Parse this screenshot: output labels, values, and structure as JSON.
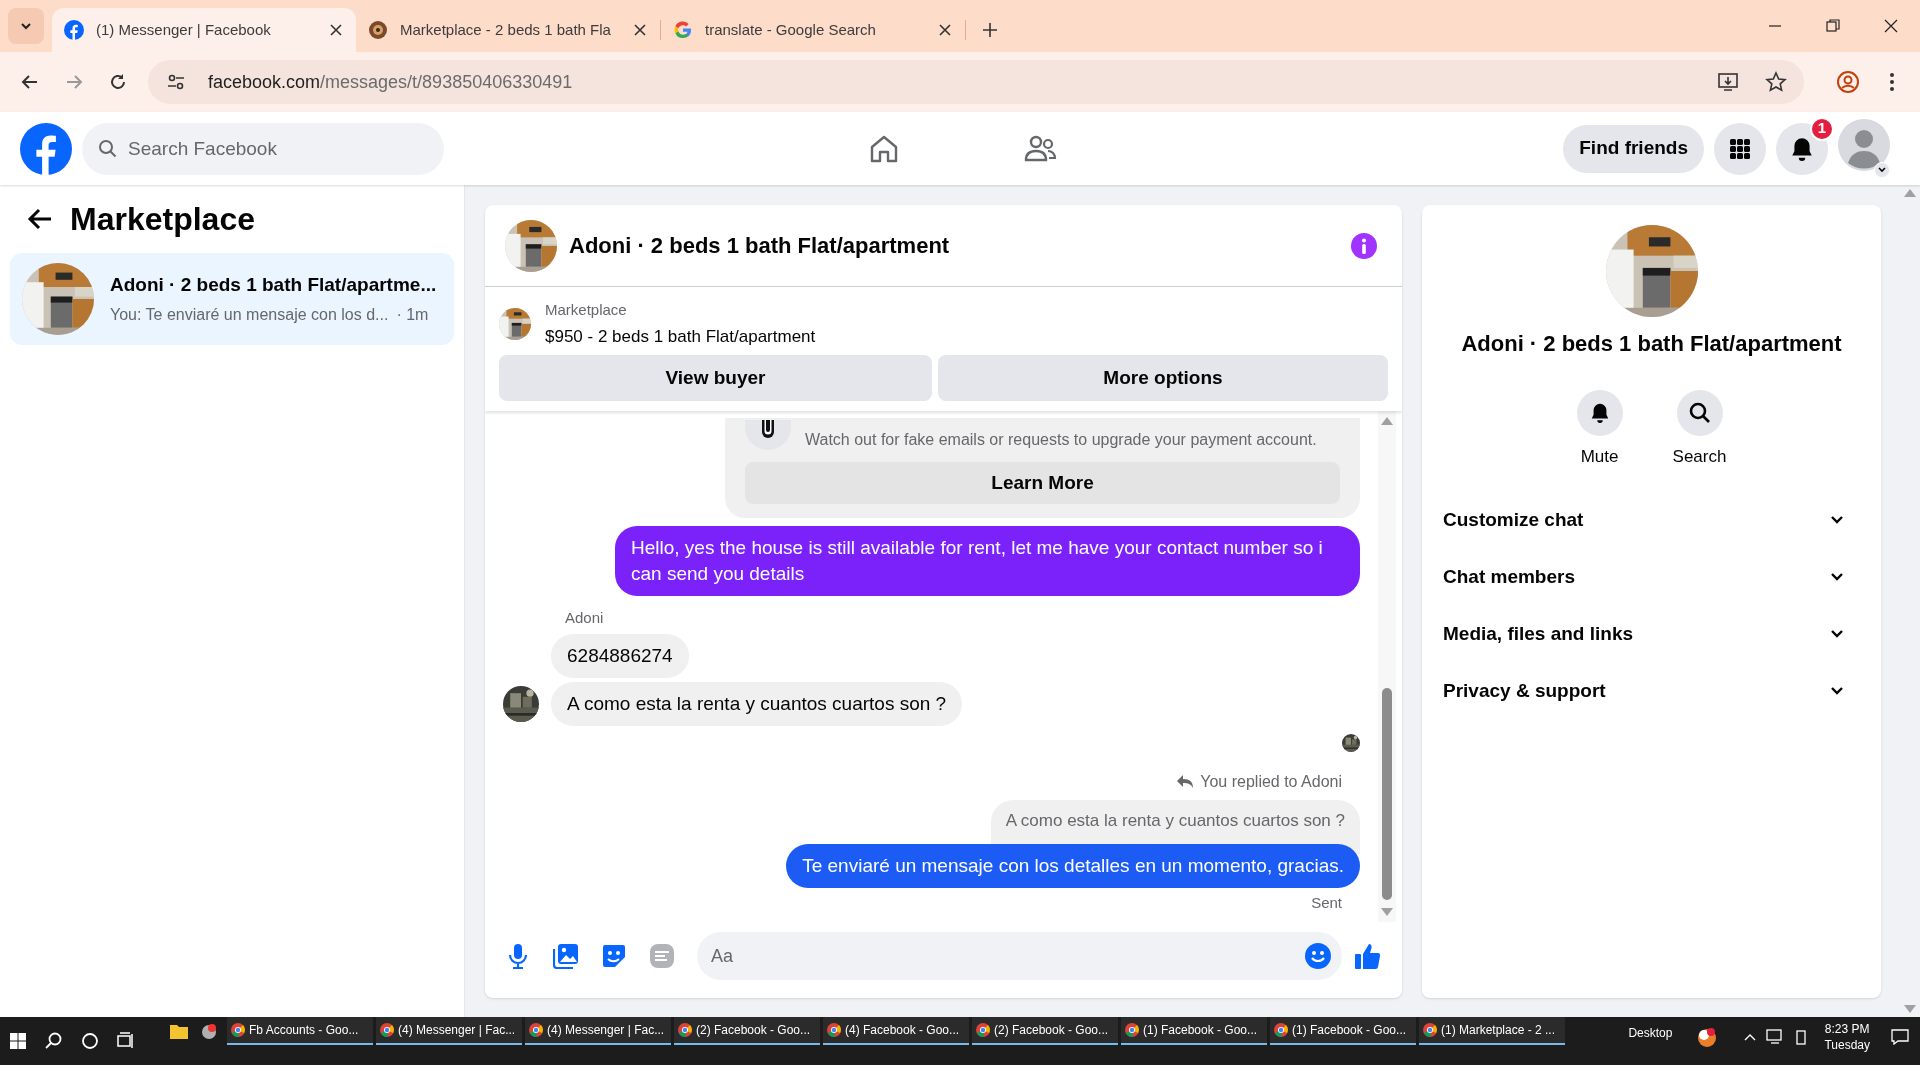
{
  "browser": {
    "tabs": [
      {
        "title": "(1) Messenger | Facebook",
        "selected": true
      },
      {
        "title": "Marketplace - 2 beds 1 bath Fla",
        "selected": false
      },
      {
        "title": "translate - Google Search",
        "selected": false
      }
    ],
    "url_host": "facebook.com",
    "url_path": "/messages/t/893850406330491"
  },
  "header": {
    "search_placeholder": "Search Facebook",
    "find_friends": "Find friends",
    "notification_count": "1"
  },
  "sidebar": {
    "title": "Marketplace",
    "conversations": [
      {
        "title": "Adoni · 2 beds 1 bath Flat/apartme...",
        "preview": "You: Te enviaré un mensaje con los d...",
        "time": "· 1m",
        "selected": true
      }
    ]
  },
  "chat": {
    "title": "Adoni · 2 beds 1 bath Flat/apartment",
    "listing": {
      "source": "Marketplace",
      "title": "$950 - 2 beds 1 bath Flat/apartment"
    },
    "buttons": [
      "View buyer",
      "More options"
    ],
    "notice": {
      "text": "Watch out for fake emails or requests to upgrade your payment account.",
      "button": "Learn More"
    },
    "messages": [
      {
        "kind": "sent",
        "text": "Hello, yes the house is still available for rent, let me have your contact number so i can send you details",
        "color": "#7b22fb"
      },
      {
        "kind": "sender",
        "text": "Adoni"
      },
      {
        "kind": "received",
        "text": "6284886274",
        "avatar": false
      },
      {
        "kind": "received",
        "text": "A como esta la renta y cuantos cuartos son ?",
        "avatar": true
      },
      {
        "kind": "seen"
      },
      {
        "kind": "reply_label",
        "text": "You replied to Adoni"
      },
      {
        "kind": "quoted",
        "text": "A como esta la renta y cuantos cuartos son ?"
      },
      {
        "kind": "sent",
        "text": "Te enviaré un mensaje con los detalles en un momento, gracias.",
        "color": "#1c5cf5"
      },
      {
        "kind": "status",
        "text": "Sent"
      }
    ],
    "composer_placeholder": "Aa"
  },
  "details": {
    "title": "Adoni · 2 beds 1 bath Flat/apartment",
    "actions": [
      {
        "kind": "bell",
        "label": "Mute"
      },
      {
        "kind": "search",
        "label": "Search"
      }
    ],
    "sections": [
      {
        "label": "Customize chat",
        "expanded": false
      },
      {
        "label": "Chat members",
        "expanded": false
      },
      {
        "label": "Media, files and links",
        "expanded": false
      },
      {
        "label": "Privacy & support",
        "expanded": false
      }
    ]
  },
  "taskbar": {
    "windows": [
      "Fb Accounts - Goo...",
      "(4) Messenger | Fac...",
      "(4) Messenger | Fac...",
      "(2) Facebook - Goo...",
      "(4) Facebook - Goo...",
      "(2) Facebook - Goo...",
      "(1) Facebook - Goo...",
      "(1) Facebook - Goo...",
      "(1) Marketplace - 2 ..."
    ],
    "desktop": "Desktop",
    "time": "8:23 PM",
    "day": "Tuesday"
  }
}
